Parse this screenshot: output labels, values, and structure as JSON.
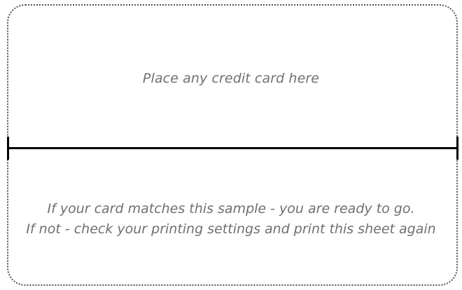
{
  "calibration": {
    "place_card_text": "Place any credit card here",
    "match_text": "If your card matches this sample - you are ready to go.",
    "mismatch_text": "If not - check your printing settings and print this sheet again"
  },
  "colors": {
    "text": "#707070",
    "ruler": "#000000",
    "frame": "#555555"
  }
}
